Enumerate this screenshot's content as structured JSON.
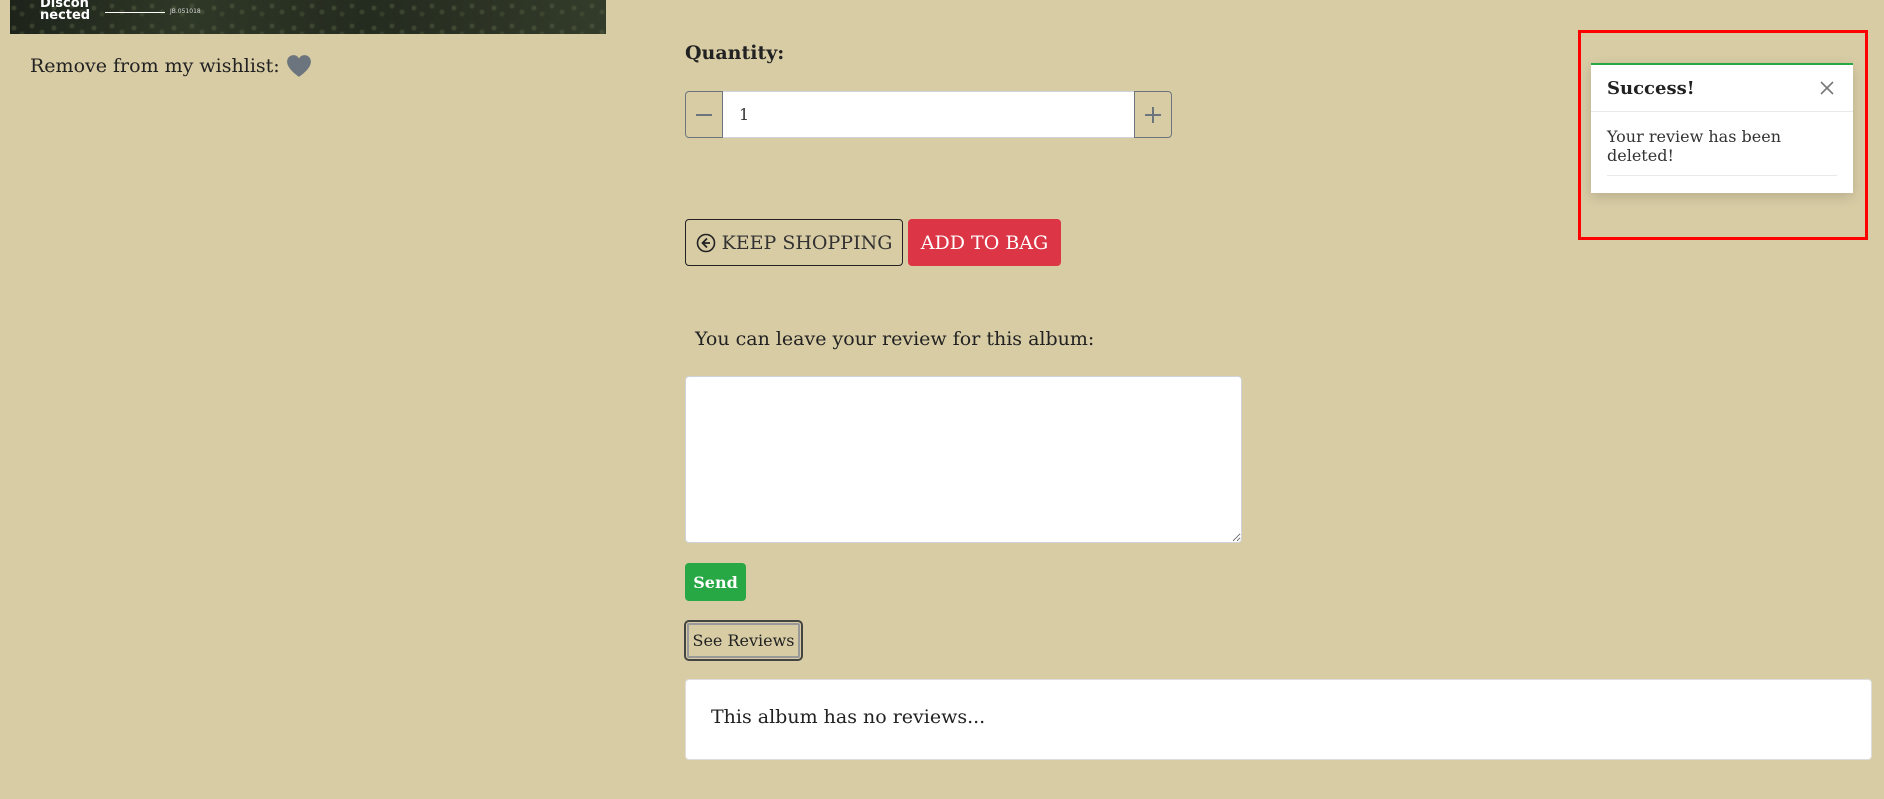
{
  "album": {
    "cover_title": "Discon nected",
    "cover_code": "JB.051018"
  },
  "wishlist": {
    "label": "Remove from my wishlist:",
    "icon": "heart-icon",
    "icon_color": "#6c757d"
  },
  "quantity": {
    "label": "Quantity:",
    "value": "1",
    "minus_icon": "minus-icon",
    "plus_icon": "plus-icon"
  },
  "actions": {
    "keep_shopping_label": "KEEP SHOPPING",
    "keep_shopping_icon": "circle-arrow-left-icon",
    "add_to_bag_label": "ADD TO BAG",
    "add_to_bag_color": "#dc3545"
  },
  "review": {
    "prompt": "You can leave your review for this album:",
    "textarea_value": "",
    "send_label": "Send",
    "send_color": "#28a745",
    "see_reviews_label": "See Reviews",
    "no_reviews_text": "This album has no reviews..."
  },
  "toast": {
    "title": "Success!",
    "message": "Your review has been deleted!",
    "close_icon": "close-icon",
    "accent_color": "#28a745",
    "highlight_color": "#ff0000"
  },
  "colors": {
    "page_background": "#d8cca5"
  }
}
